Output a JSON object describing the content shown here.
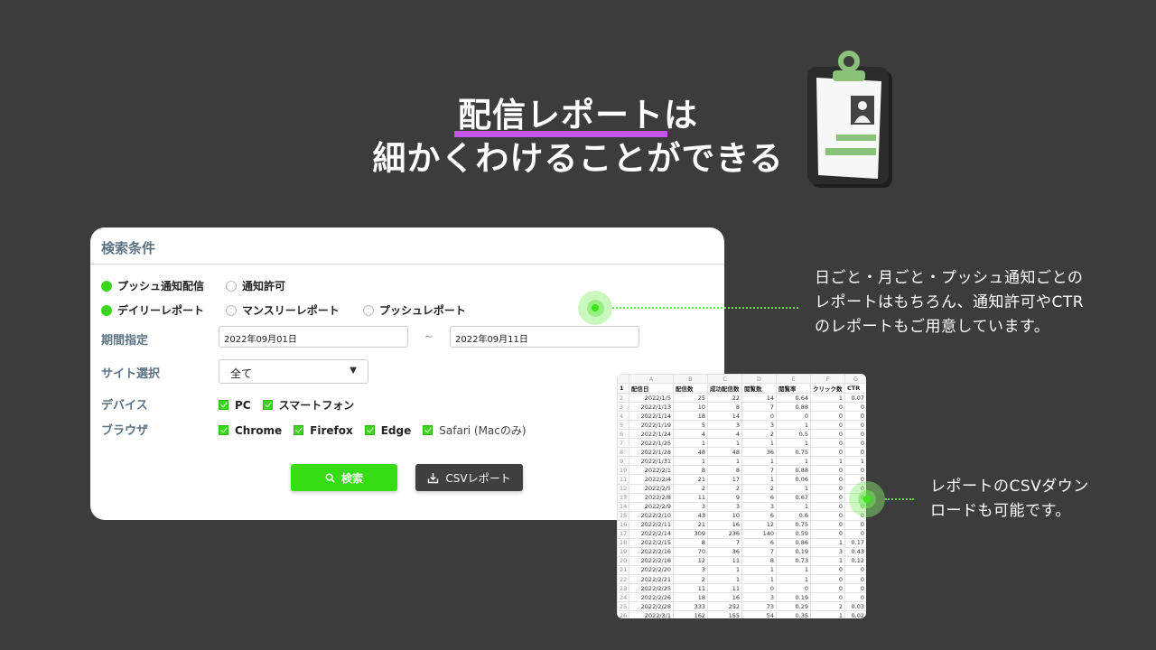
{
  "headline": {
    "highlight": "配信レポート",
    "line1_rest": "は",
    "line2": "細かくわけることができる"
  },
  "colors": {
    "background": "#3c3c3c",
    "highlight_underline": "#c355e8",
    "accent_green": "#36dd14",
    "dark_button": "#404040"
  },
  "illustration": {
    "icon": "clipboard-id-icon"
  },
  "form": {
    "title": "検索条件",
    "report_type_row1": [
      {
        "label": "プッシュ通知配信",
        "selected": true
      },
      {
        "label": "通知許可",
        "selected": false
      }
    ],
    "report_type_row2": [
      {
        "label": "デイリーレポート",
        "selected": true
      },
      {
        "label": "マンスリーレポート",
        "selected": false
      },
      {
        "label": "プッシュレポート",
        "selected": false
      }
    ],
    "period": {
      "label": "期間指定",
      "start": "2022年09月01日",
      "separator": "~",
      "end": "2022年09月11日"
    },
    "site": {
      "label": "サイト選択",
      "value": "全て"
    },
    "device": {
      "label": "デバイス",
      "options": [
        {
          "label": "PC",
          "checked": true
        },
        {
          "label": "スマートフォン",
          "checked": true
        }
      ]
    },
    "browser": {
      "label": "ブラウザ",
      "options": [
        {
          "label": "Chrome",
          "checked": true
        },
        {
          "label": "Firefox",
          "checked": true
        },
        {
          "label": "Edge",
          "checked": true
        },
        {
          "label": "Safari (Macのみ)",
          "checked": true
        }
      ]
    },
    "search_button": "検索",
    "csv_button": "CSVレポート"
  },
  "notes": {
    "report_types": "日ごと・月ごと・プッシュ通知ごとの\nレポートはもちろん、通知許可やCTR\nのレポートもご用意しています。",
    "csv": "レポートのCSVダウン\nロードも可能です。"
  },
  "spreadsheet": {
    "column_letters": [
      "A",
      "B",
      "C",
      "D",
      "E",
      "F",
      "G"
    ],
    "headers": [
      "配信日",
      "配信数",
      "成功配信数",
      "閲覧数",
      "閲覧率",
      "クリック数",
      "CTR"
    ],
    "rows": [
      [
        "2022/1/5",
        "25",
        "22",
        "14",
        "0.64",
        "1",
        "0.07"
      ],
      [
        "2022/1/13",
        "10",
        "8",
        "7",
        "0.88",
        "0",
        "0"
      ],
      [
        "2022/1/14",
        "18",
        "14",
        "0",
        "0",
        "0",
        "0"
      ],
      [
        "2022/1/19",
        "5",
        "3",
        "3",
        "1",
        "0",
        "0"
      ],
      [
        "2022/1/24",
        "4",
        "4",
        "2",
        "0.5",
        "0",
        "0"
      ],
      [
        "2022/1/25",
        "1",
        "1",
        "1",
        "1",
        "0",
        "0"
      ],
      [
        "2022/1/28",
        "48",
        "48",
        "36",
        "0.75",
        "0",
        "0"
      ],
      [
        "2022/1/31",
        "1",
        "1",
        "1",
        "1",
        "1",
        "1"
      ],
      [
        "2022/2/1",
        "8",
        "8",
        "7",
        "0.88",
        "0",
        "0"
      ],
      [
        "2022/2/4",
        "21",
        "17",
        "1",
        "0.06",
        "0",
        "0"
      ],
      [
        "2022/2/5",
        "2",
        "2",
        "2",
        "1",
        "0",
        "0"
      ],
      [
        "2022/2/8",
        "11",
        "9",
        "6",
        "0.67",
        "0",
        "0"
      ],
      [
        "2022/2/9",
        "3",
        "3",
        "3",
        "1",
        "0",
        "0"
      ],
      [
        "2022/2/10",
        "43",
        "10",
        "6",
        "0.6",
        "0",
        "0"
      ],
      [
        "2022/2/11",
        "21",
        "16",
        "12",
        "0.75",
        "0",
        "0"
      ],
      [
        "2022/2/14",
        "309",
        "236",
        "140",
        "0.59",
        "0",
        "0"
      ],
      [
        "2022/2/15",
        "8",
        "7",
        "6",
        "0.86",
        "1",
        "0.17"
      ],
      [
        "2022/2/16",
        "70",
        "36",
        "7",
        "0.19",
        "3",
        "0.43"
      ],
      [
        "2022/2/18",
        "12",
        "11",
        "8",
        "0.73",
        "1",
        "0.12"
      ],
      [
        "2022/2/20",
        "3",
        "1",
        "1",
        "1",
        "0",
        "0"
      ],
      [
        "2022/2/21",
        "2",
        "1",
        "1",
        "1",
        "0",
        "0"
      ],
      [
        "2022/2/25",
        "11",
        "11",
        "0",
        "0",
        "0",
        "0"
      ],
      [
        "2022/2/26",
        "18",
        "16",
        "3",
        "0.19",
        "0",
        "0"
      ],
      [
        "2022/2/28",
        "333",
        "252",
        "73",
        "0.29",
        "2",
        "0.03"
      ],
      [
        "2022/3/1",
        "162",
        "155",
        "54",
        "0.35",
        "1",
        "0.02"
      ]
    ]
  }
}
